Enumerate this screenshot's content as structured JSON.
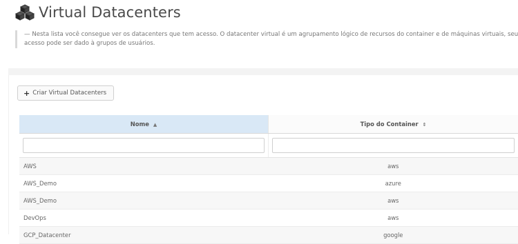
{
  "header": {
    "title": "Virtual Datacenters",
    "description": "— Nesta lista você consegue ver os datacenters que tem acesso. O datacenter virtual é um agrupamento lógico de recursos do container e de máquinas virtuais, seu acesso pode ser dado à grupos de usuários."
  },
  "toolbar": {
    "create_label": "Criar Virtual Datacenters",
    "create_icon": "plus-icon"
  },
  "table": {
    "columns": [
      {
        "label": "Nome",
        "sort_icon": "▲",
        "sort": "ascending"
      },
      {
        "label": "Tipo do Container",
        "sort_icon": "⇕",
        "sort": "none"
      }
    ],
    "filters": [
      {
        "value": "",
        "placeholder": ""
      },
      {
        "value": "",
        "placeholder": ""
      }
    ],
    "rows": [
      {
        "name": "AWS",
        "type": "aws"
      },
      {
        "name": "AWS_Demo",
        "type": "azure"
      },
      {
        "name": "AWS_Demo",
        "type": "aws"
      },
      {
        "name": "DevOps",
        "type": "aws"
      },
      {
        "name": "GCP_Datacenter",
        "type": "google"
      }
    ]
  },
  "colors": {
    "sorted_header_bg": "#d9e8f6",
    "stripe_bg": "#f7f7f7"
  }
}
